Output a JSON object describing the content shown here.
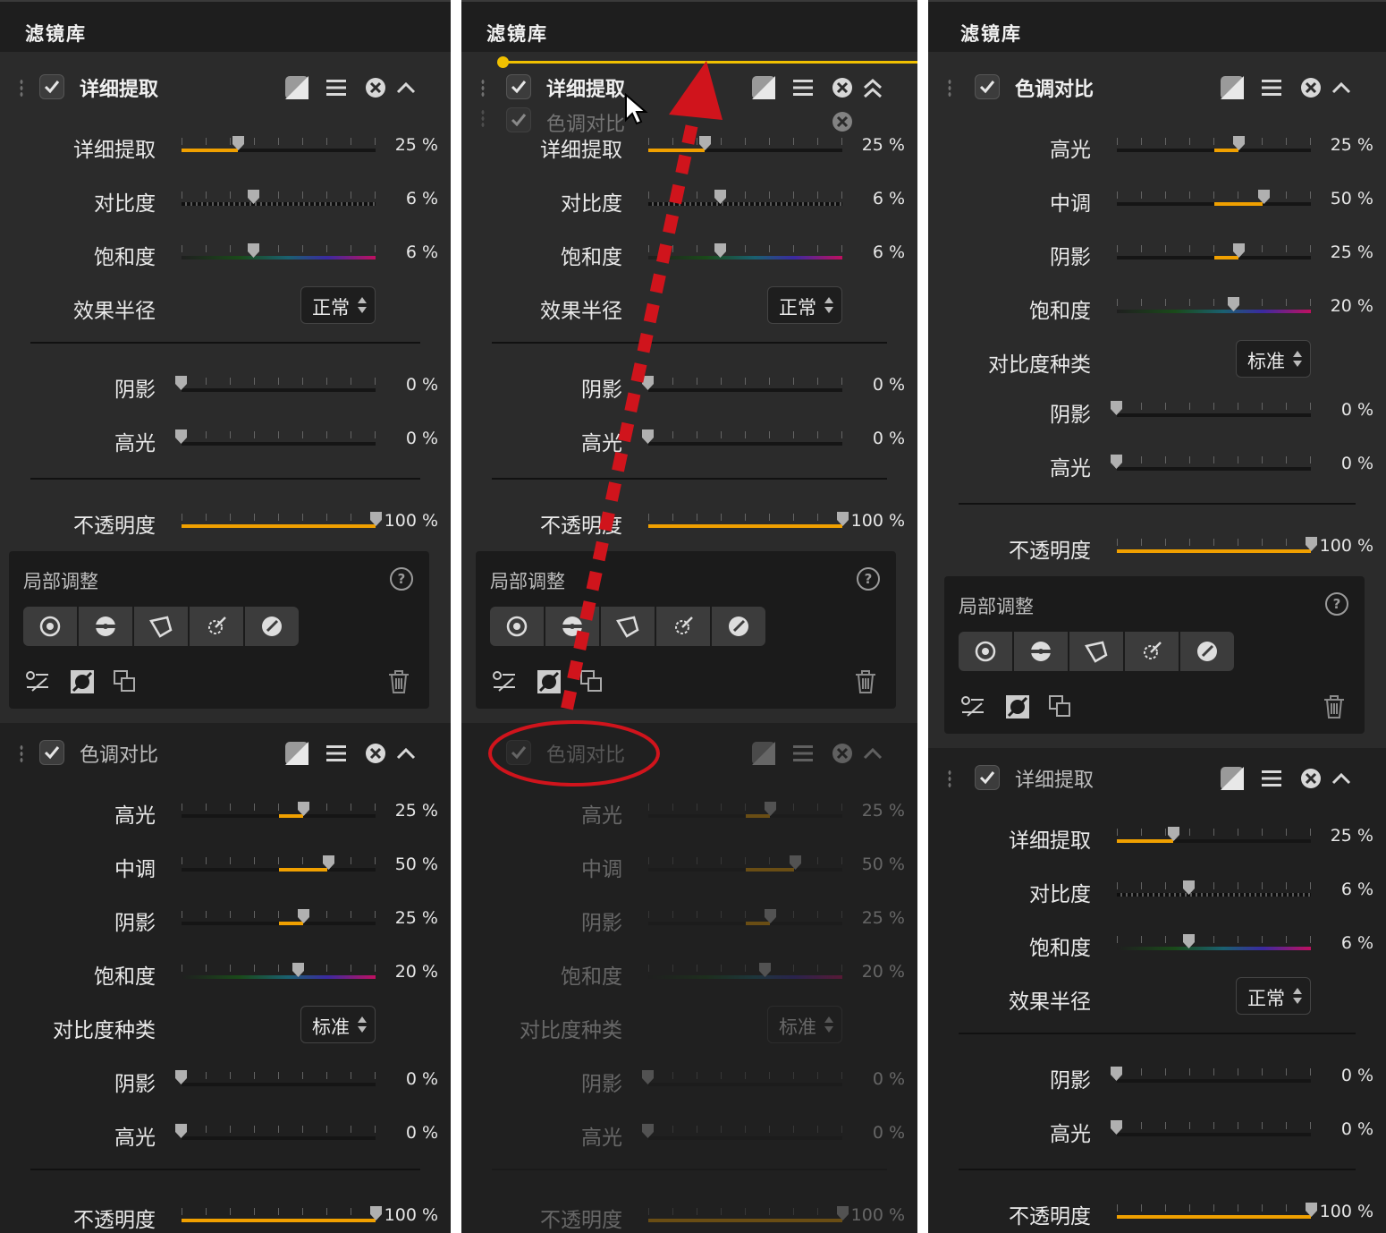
{
  "panels": [
    {
      "title": "滤镜库",
      "modules": [
        {
          "title": "详细提取",
          "checked": true,
          "sliders": [
            {
              "label": "详细提取",
              "value": 25,
              "display": "25 %",
              "style": "orange"
            },
            {
              "label": "对比度",
              "value": 6,
              "display": "6 %",
              "style": "contrast"
            },
            {
              "label": "饱和度",
              "value": 6,
              "display": "6 %",
              "style": "saturation"
            }
          ],
          "select": {
            "label": "效果半径",
            "value": "正常"
          },
          "sliders2": [
            {
              "label": "阴影",
              "value": 0,
              "display": "0 %"
            },
            {
              "label": "高光",
              "value": 0,
              "display": "0 %"
            }
          ],
          "opacity": {
            "label": "不透明度",
            "value": 100,
            "display": "100 %"
          }
        },
        {
          "title": "色调对比",
          "checked": true,
          "sliders": [
            {
              "label": "高光",
              "value": 25,
              "display": "25 %"
            },
            {
              "label": "中调",
              "value": 50,
              "display": "50 %"
            },
            {
              "label": "阴影",
              "value": 25,
              "display": "25 %"
            },
            {
              "label": "饱和度",
              "value": 20,
              "display": "20 %"
            }
          ],
          "select": {
            "label": "对比度种类",
            "value": "标准"
          },
          "sliders2": [
            {
              "label": "阴影",
              "value": 0,
              "display": "0 %"
            },
            {
              "label": "高光",
              "value": 0,
              "display": "0 %"
            }
          ],
          "opacity": {
            "label": "不透明度",
            "value": 100,
            "display": "100 %"
          }
        }
      ],
      "local": {
        "title": "局部调整",
        "help": "?"
      }
    },
    {
      "title": "滤镜库",
      "drag_ghost": "色调对比",
      "drag_source_label": "色调对比"
    },
    {
      "title": "滤镜库"
    }
  ],
  "colors": {
    "accent": "#f0a000",
    "drop_line": "#f0c000",
    "arrow": "#d0141c",
    "panel": "#2b2b2b",
    "header": "#1e1e1e"
  },
  "icons": [
    "checkbox-icon",
    "mask-icon",
    "menu-icon",
    "close-circle-icon",
    "chevron-up-icon",
    "help-icon",
    "control-point-icon",
    "selection-brush-icon",
    "polygon-icon",
    "auto-point-icon",
    "brush-icon",
    "link-icon",
    "invert-icon",
    "copy-icon",
    "trash-icon",
    "cursor-icon"
  ]
}
